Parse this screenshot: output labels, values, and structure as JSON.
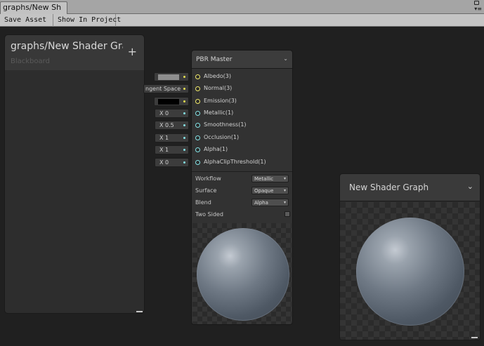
{
  "window": {
    "tab_title": "graphs/New Sh"
  },
  "toolbar": {
    "save_asset": "Save Asset",
    "show_in_project": "Show In Project"
  },
  "blackboard": {
    "title": "graphs/New Shader Grap",
    "subtitle": "Blackboard",
    "add_symbol": "+"
  },
  "inputs": [
    {
      "value": "",
      "swatch": "#8e8e8e",
      "dot": "#e6e04f"
    },
    {
      "value": "ngent Space",
      "dot": "#e6e04f"
    },
    {
      "value": "",
      "swatch": "#000000",
      "dot": "#e6e04f"
    },
    {
      "value": "X 0",
      "dot": "#84e4e7"
    },
    {
      "value": "X 0.5",
      "dot": "#84e4e7"
    },
    {
      "value": "X 1",
      "dot": "#84e4e7"
    },
    {
      "value": "X 1",
      "dot": "#84e4e7"
    },
    {
      "value": "X 0",
      "dot": "#84e4e7"
    }
  ],
  "master": {
    "title": "PBR Master",
    "slots": [
      {
        "label": "Albedo(3)",
        "color": "#f0e96a"
      },
      {
        "label": "Normal(3)",
        "color": "#f0e96a"
      },
      {
        "label": "Emission(3)",
        "color": "#f0e96a"
      },
      {
        "label": "Metallic(1)",
        "color": "#84e4e7"
      },
      {
        "label": "Smoothness(1)",
        "color": "#84e4e7"
      },
      {
        "label": "Occlusion(1)",
        "color": "#84e4e7"
      },
      {
        "label": "Alpha(1)",
        "color": "#84e4e7"
      },
      {
        "label": "AlphaClipThreshold(1)",
        "color": "#84e4e7"
      }
    ],
    "options": {
      "workflow_label": "Workflow",
      "workflow_value": "Metallic",
      "surface_label": "Surface",
      "surface_value": "Opaque",
      "blend_label": "Blend",
      "blend_value": "Alpha",
      "two_sided_label": "Two Sided",
      "two_sided_checked": false
    }
  },
  "preview": {
    "title": "New Shader Graph"
  },
  "icons": {
    "chevron": "chevron-down-icon",
    "add": "plus-icon",
    "lock": "lock-icon",
    "menu": "menu-icon"
  }
}
